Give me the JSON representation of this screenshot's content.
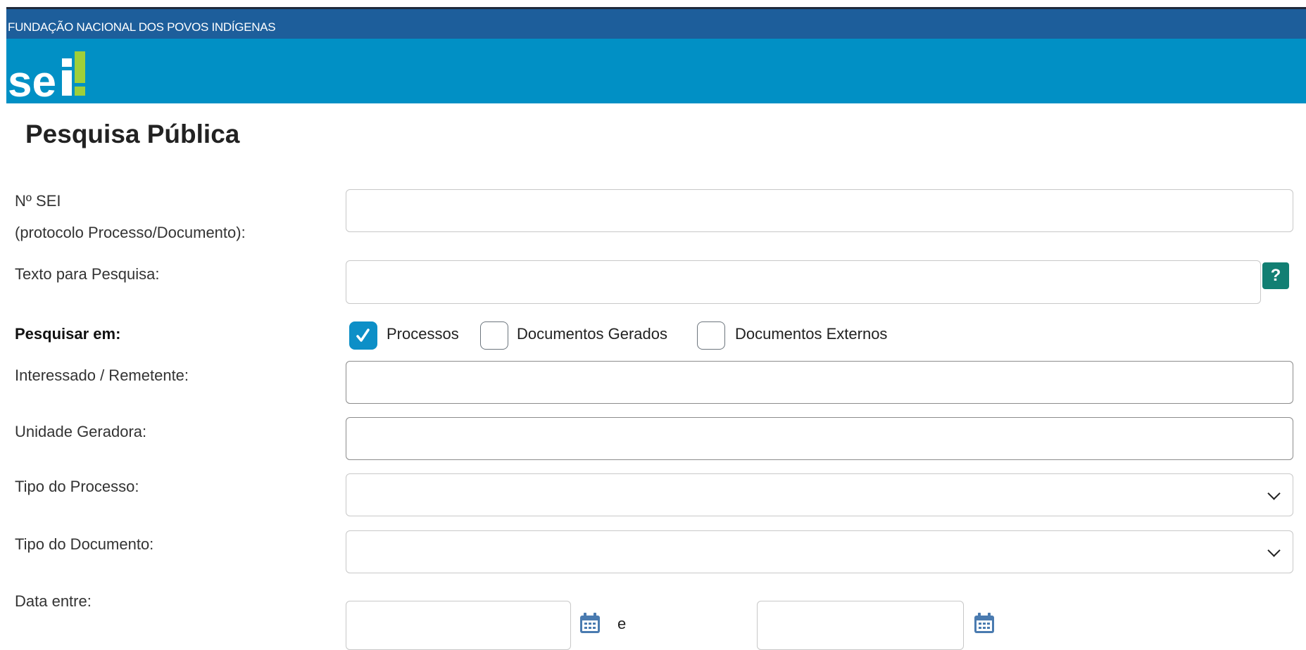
{
  "header": {
    "org_name": "FUNDAÇÃO NACIONAL DOS POVOS INDÍGENAS",
    "logo_text": "sei!"
  },
  "page": {
    "title": "Pesquisa Pública"
  },
  "form": {
    "sei_number": {
      "label_line1": "Nº SEI",
      "label_line2": "(protocolo Processo/Documento):",
      "value": ""
    },
    "search_text": {
      "label": "Texto para Pesquisa:",
      "value": "",
      "help_label": "?"
    },
    "search_in": {
      "label": "Pesquisar em:",
      "options": [
        {
          "label": "Processos",
          "checked": true
        },
        {
          "label": "Documentos Gerados",
          "checked": false
        },
        {
          "label": "Documentos Externos",
          "checked": false
        }
      ]
    },
    "interested": {
      "label": "Interessado / Remetente:",
      "value": ""
    },
    "unit": {
      "label": "Unidade Geradora:",
      "value": ""
    },
    "process_type": {
      "label": "Tipo do Processo:",
      "selected": ""
    },
    "document_type": {
      "label": "Tipo do Documento:",
      "selected": ""
    },
    "date_range": {
      "label": "Data entre:",
      "separator": "e",
      "start": "",
      "end": ""
    }
  },
  "colors": {
    "org_bar": "#1d5e9b",
    "header": "#0190c5",
    "checkbox_checked": "#0d8fc7",
    "help_button": "#127f73",
    "calendar_icon": "#4a7bb0"
  },
  "icons": {
    "help": "question-icon",
    "calendar": "calendar-icon",
    "select": "chevron-down-icon",
    "check": "checkmark-icon"
  }
}
